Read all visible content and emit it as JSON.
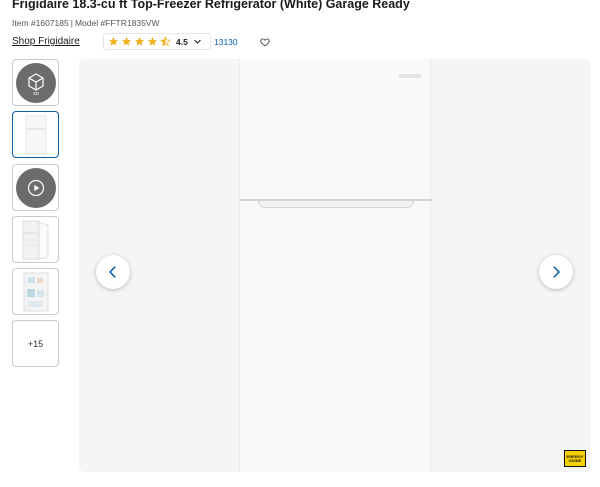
{
  "product": {
    "title": "Frigidaire 18.3-cu ft Top-Freezer Refrigerator (White) Garage Ready",
    "item_number": "Item #1607185",
    "separator": "|",
    "model_number": "Model #FFTR1835VW",
    "shop_brand_label": "Shop Frigidaire"
  },
  "rating": {
    "value": "4.5",
    "stars_filled": 4.5,
    "stars_total": 5,
    "review_count": "13130",
    "star_color": "#f2b01e"
  },
  "gallery": {
    "thumbnails": [
      {
        "kind": "3d",
        "icon": "cube-3d-icon",
        "label": "3D"
      },
      {
        "kind": "image",
        "icon": "fridge-thumbnail",
        "selected": true
      },
      {
        "kind": "video",
        "icon": "play-icon"
      },
      {
        "kind": "image",
        "icon": "open-fridge-thumbnail"
      },
      {
        "kind": "image",
        "icon": "fridge-interior-thumbnail"
      },
      {
        "kind": "more",
        "label": "+15"
      }
    ],
    "prev_icon": "chevron-left-icon",
    "next_icon": "chevron-right-icon",
    "energy_badge": {
      "line1": "ENERGY",
      "line2": "GUIDE"
    }
  },
  "colors": {
    "link_blue": "#0a5fa8",
    "selected_border": "#0a5fa8",
    "image_background": "#f5f5f5",
    "energy_yellow": "#f3d000"
  }
}
